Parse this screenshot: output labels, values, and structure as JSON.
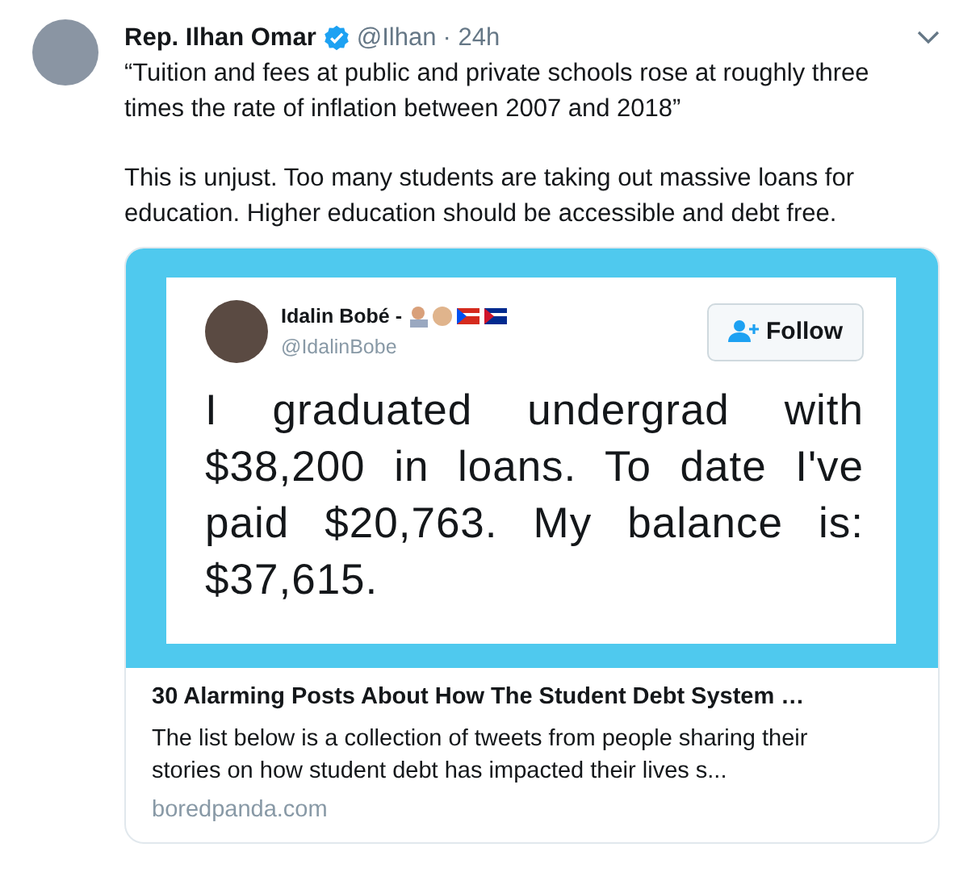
{
  "tweet": {
    "name": "Rep. Ilhan Omar",
    "verified": true,
    "handle": "@Ilhan",
    "time": "· 24h",
    "text": [
      "“Tuition and fees at public and private schools rose at roughly three times the rate of inflation between 2007 and 2018”",
      "This is unjust. Too many students are taking out massive loans for education. Higher education should be accessible and debt free."
    ],
    "card": {
      "embedded_tweet": {
        "name": "Idalin Bobé -",
        "handle": "@IdalinBobe",
        "follow_label": "Follow",
        "text": "I graduated undergrad with $38,200 in loans. To date I've paid $20,763. My balance is: $37,615."
      },
      "title": "30 Alarming Posts About How The Student Debt System …",
      "description": "The list below is a collection of tweets from people sharing their stories on how student debt has impacted their lives s...",
      "domain": "boredpanda.com"
    }
  }
}
